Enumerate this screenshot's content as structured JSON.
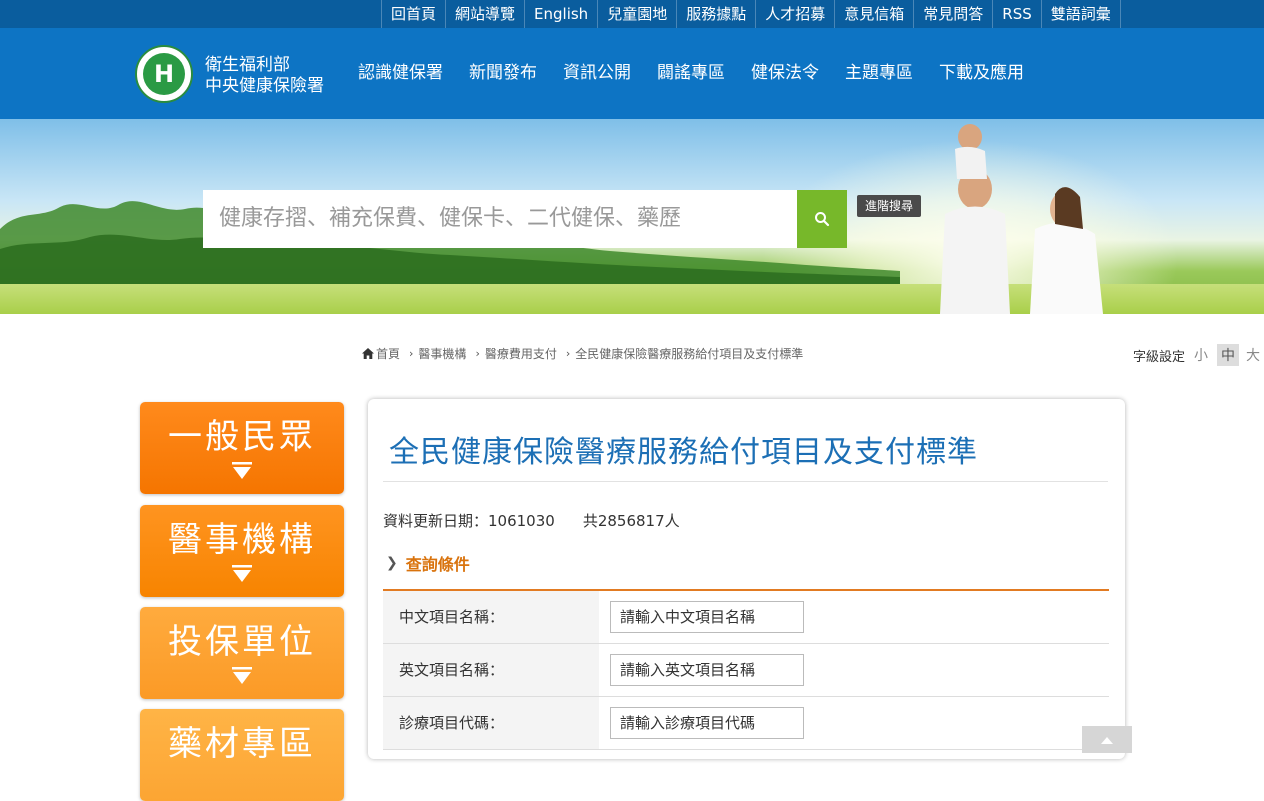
{
  "topbar": {
    "links": [
      "回首頁",
      "網站導覽",
      "English",
      "兒童園地",
      "服務據點",
      "人才招募",
      "意見信箱",
      "常見問答",
      "RSS",
      "雙語詞彙"
    ]
  },
  "header": {
    "org_line1": "衛生福利部",
    "org_line2": "中央健康保險署",
    "nav": [
      "認識健保署",
      "新聞發布",
      "資訊公開",
      "闢謠專區",
      "健保法令",
      "主題專區",
      "下載及應用"
    ]
  },
  "search": {
    "placeholder": "健康存摺、補充保費、健保卡、二代健保、藥歷",
    "button_icon": "search-icon",
    "advanced_label": "進階搜尋"
  },
  "breadcrumb": {
    "items": [
      "首頁",
      "醫事機構",
      "醫療費用支付",
      "全民健康保險醫療服務給付項目及支付標準"
    ]
  },
  "font_size": {
    "label": "字級設定",
    "options": [
      "小",
      "中",
      "大"
    ],
    "selected": "中"
  },
  "sidebar": {
    "items": [
      {
        "label": "一般民眾",
        "color": "#ff7f0e"
      },
      {
        "label": "醫事機構",
        "color": "#ff8c0f"
      },
      {
        "label": "投保單位",
        "color": "#ffa332"
      },
      {
        "label": "藥材專區",
        "color": "#ffad3a"
      }
    ]
  },
  "content": {
    "title": "全民健康保險醫療服務給付項目及支付標準",
    "update_date": "資料更新日期：1061030",
    "count": "共2856817人",
    "query_heading": "查詢條件",
    "fields": [
      {
        "label": "中文項目名稱：",
        "placeholder": "請輸入中文項目名稱"
      },
      {
        "label": "英文項目名稱：",
        "placeholder": "請輸入英文項目名稱"
      },
      {
        "label": "診療項目代碼：",
        "placeholder": "請輸入診療項目代碼"
      }
    ]
  },
  "colors": {
    "topbar": "#0a5d9e",
    "header": "#0d74c4",
    "search_button": "#77b82a",
    "title": "#1c6fb5",
    "query_accent": "#e27b22"
  }
}
